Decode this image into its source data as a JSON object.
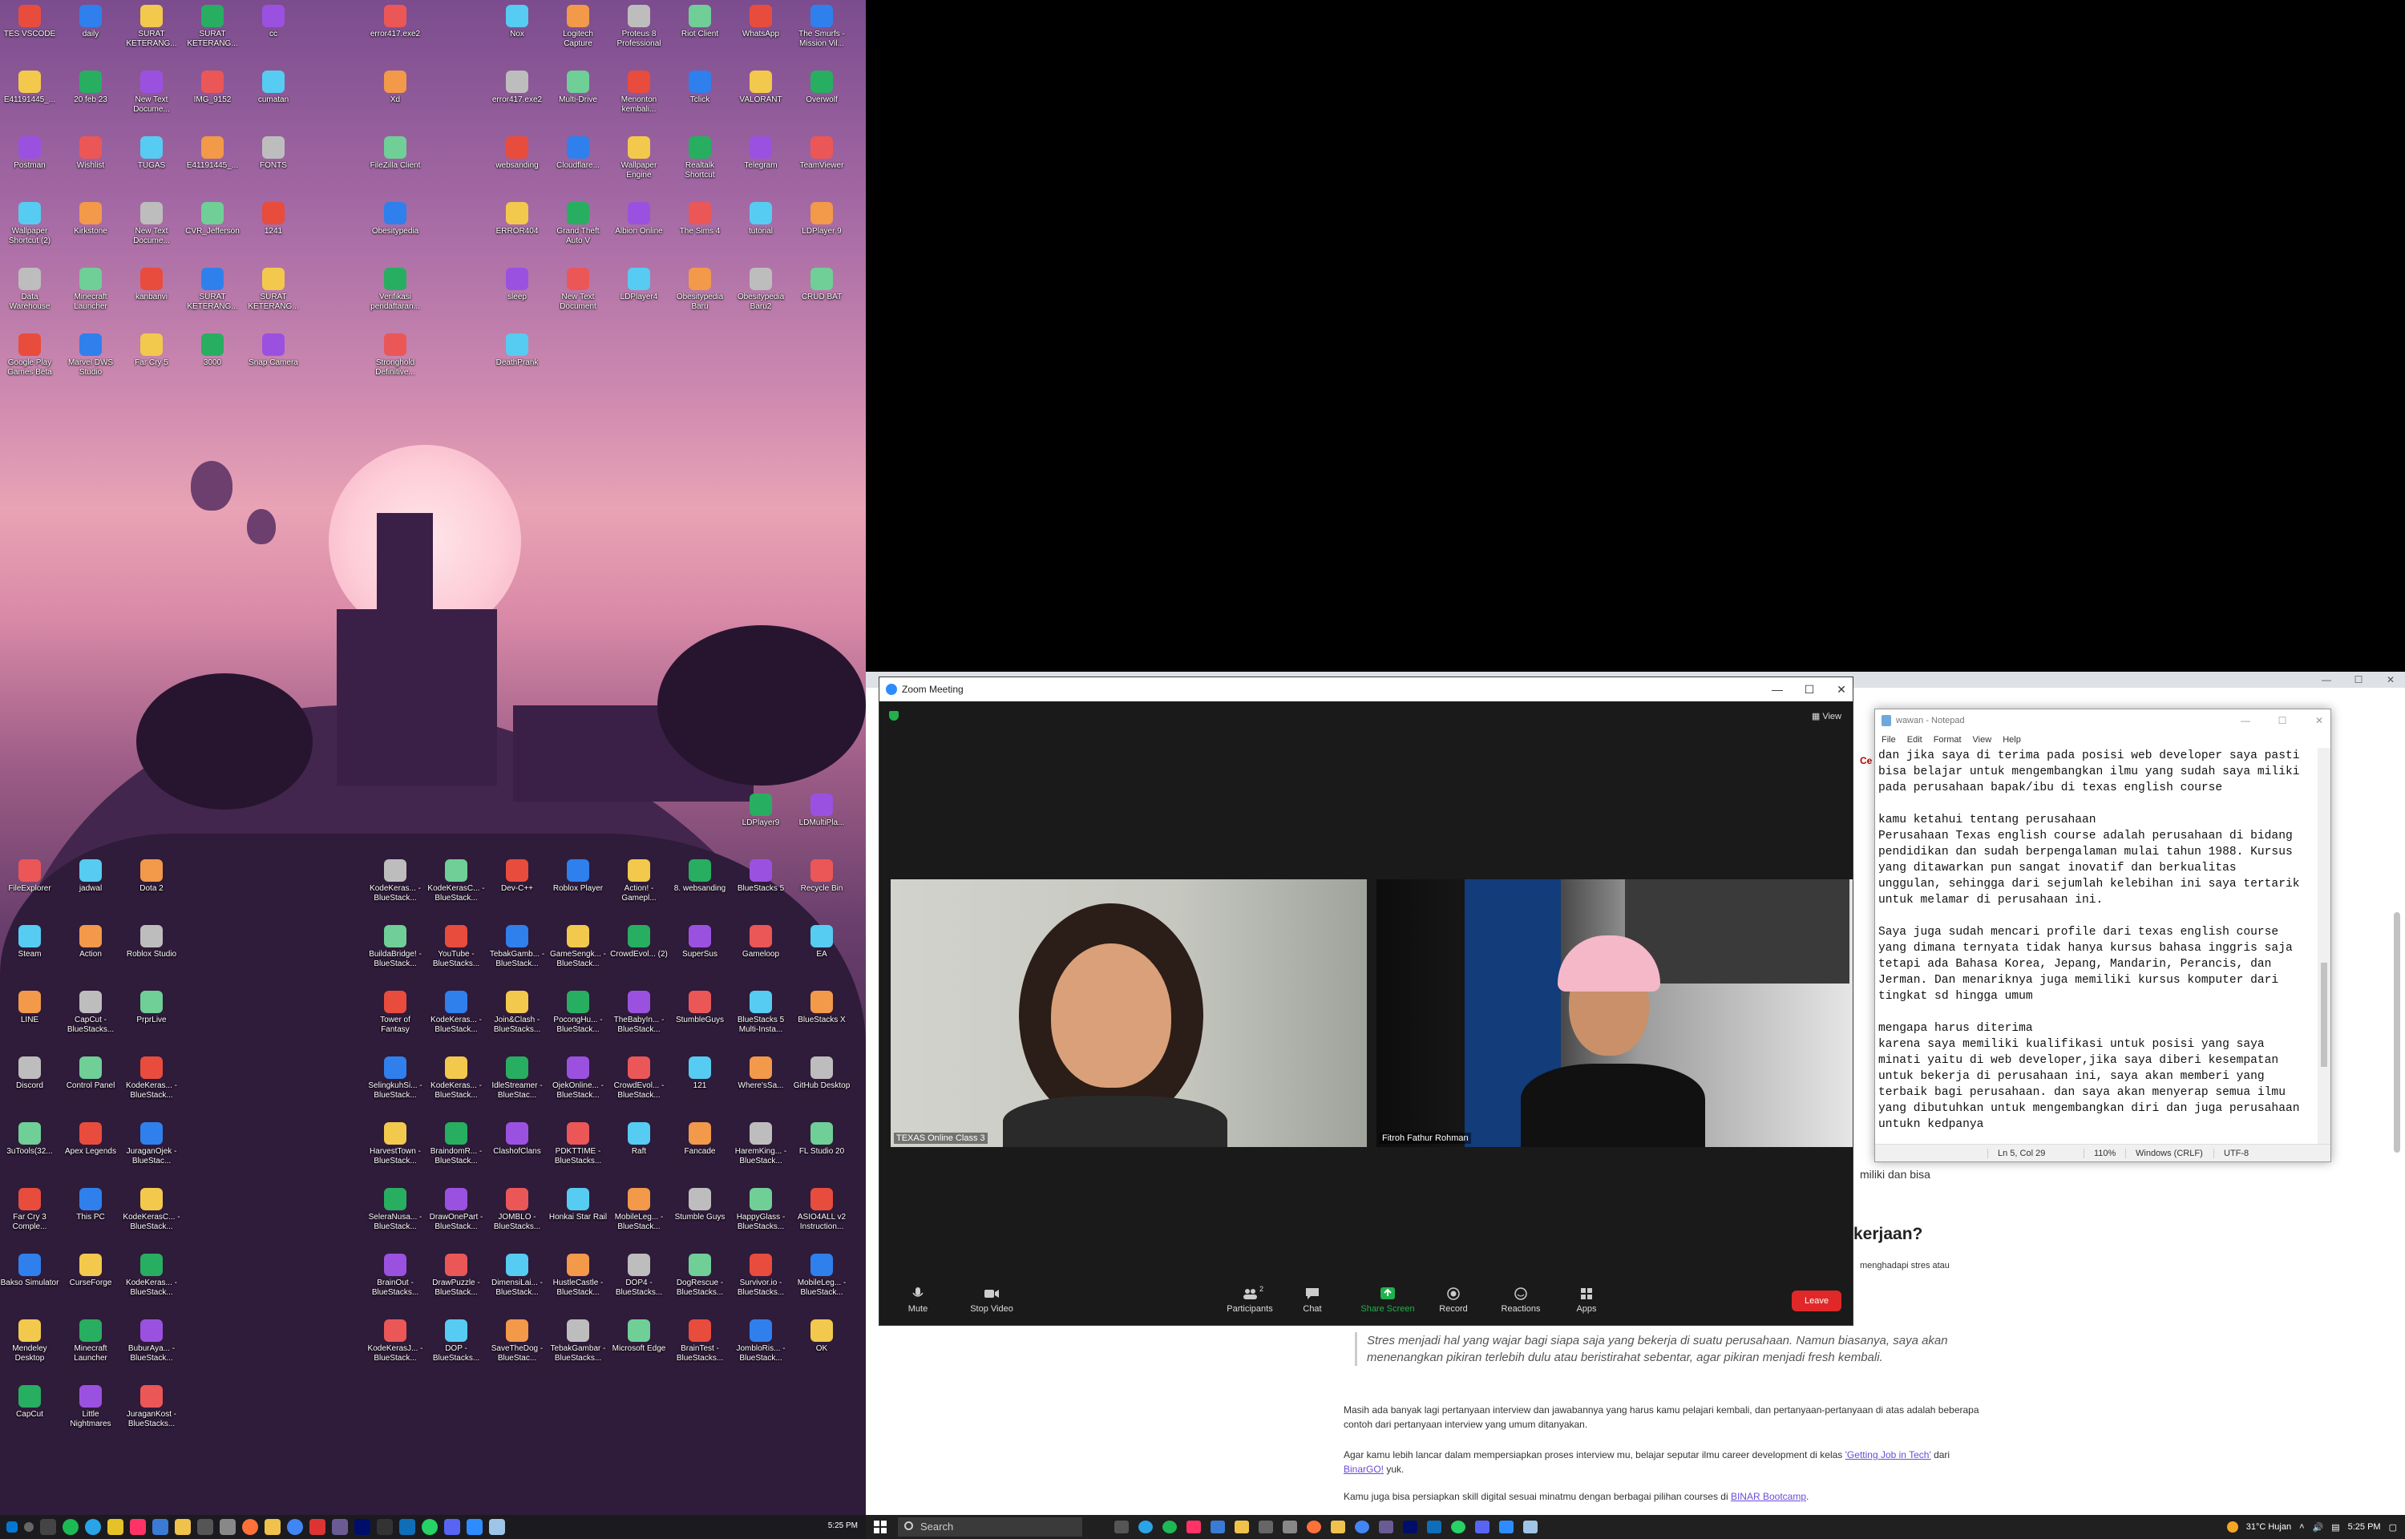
{
  "left_desktop": {
    "icons_top": [
      "TES VSCODE",
      "daily",
      "SURAT KETERANG...",
      "SURAT KETERANG...",
      "cc",
      "error417.exe2",
      "Nox",
      "Logitech Capture",
      "Proteus 8 Professional",
      "Riot Client",
      "WhatsApp",
      "The Smurfs - Mission Vil...",
      "E41191445_...",
      "20 feb 23",
      "New Text Docume...",
      "IMG_9152",
      "cumatan",
      "Xd",
      "error417.exe2",
      "Multi-Drive",
      "Menonton kembali...",
      "Tclick",
      "VALORANT",
      "Overwolf",
      "Postman",
      "Wishlist",
      "TUGAS",
      "E41191445_...",
      "FONTS",
      "FileZilla Client",
      "websanding",
      "Cloudflare...",
      "Wallpaper Engine",
      "Realtalk Shortcut",
      "Telegram",
      "TeamViewer",
      "Wallpaper Shortcut (2)",
      "Kirkstone",
      "New Text Docume...",
      "CVR_Jefferson",
      "1241",
      "Obesitypedia",
      "ERROR404",
      "Grand Theft Auto V",
      "Albion Online",
      "The Sims 4",
      "tutorial",
      "LDPlayer 9",
      "Data Warehouse",
      "Minecraft Launcher",
      "kanbanvi",
      "SURAT KETERANG...",
      "SURAT KETERANG...",
      "Verifikasi pendaftaran...",
      "sleep",
      "New Text Document",
      "LDPlayer4",
      "Obesitypedia Baru",
      "Obesitypedia Baru2",
      "CRUD BAT",
      "Google Play Games Beta",
      "Marvel DWS Studio",
      "Far Cry 5",
      "3000",
      "Snap Camera",
      "Stronghold Definitive...",
      "DeathPrank"
    ],
    "icons_bottom": [
      "LDPlayer9",
      "LDMultiPla...",
      "FileExplorer",
      "jadwal",
      "Dota 2",
      "KodeKeras... - BlueStack...",
      "KodeKerasC... - BlueStack...",
      "Dev-C++",
      "Roblox Player",
      "Action! - Gamepl...",
      "8. websanding",
      "BlueStacks 5",
      "Recycle Bin",
      "Steam",
      "Action",
      "Roblox Studio",
      "BuildaBridge! - BlueStack...",
      "YouTube - BlueStacks...",
      "TebakGamb... - BlueStack...",
      "GameSengk... - BlueStack...",
      "CrowdEvol... (2)",
      "SuperSus",
      "Gameloop",
      "EA",
      "LINE",
      "CapCut - BlueStacks...",
      "PrprLive",
      "Tower of Fantasy",
      "KodeKeras... - BlueStack...",
      "Join&Clash - BlueStacks...",
      "PocongHu... - BlueStack...",
      "TheBabyIn... - BlueStack...",
      "StumbleGuys",
      "BlueStacks 5 Multi-Insta...",
      "BlueStacks X",
      "Discord",
      "Control Panel",
      "KodeKeras... - BlueStack...",
      "SelingkuhSi... - BlueStack...",
      "KodeKeras... - BlueStack...",
      "IdleStreamer - BlueStac...",
      "OjekOnline... - BlueStack...",
      "CrowdEvol... - BlueStack...",
      "121",
      "Where'sSa...",
      "GitHub Desktop",
      "3uTools(32...",
      "Apex Legends",
      "JuraganOjek - BlueStac...",
      "HarvestTown - BlueStack...",
      "BraindomR... - BlueStack...",
      "ClashofClans",
      "PDKTTIME - BlueStacks...",
      "Raft",
      "Fancade",
      "HaremKing... - BlueStack...",
      "FL Studio 20",
      "Far Cry 3 Comple...",
      "This PC",
      "KodeKerasC... - BlueStack...",
      "SeleraNusa... - BlueStack...",
      "DrawOnePart - BlueStack...",
      "JOMBLO - BlueStacks...",
      "Honkai Star Rail",
      "MobileLeg... - BlueStack...",
      "Stumble Guys",
      "HappyGlass - BlueStacks...",
      "ASIO4ALL v2 Instruction...",
      "Bakso Simulator",
      "CurseForge",
      "KodeKeras... - BlueStack...",
      "BrainOut - BlueStacks...",
      "DrawPuzzle - BlueStack...",
      "DimensiLai... - BlueStack...",
      "HustleCastle - BlueStack...",
      "DOP4 - BlueStacks...",
      "DogRescue - BlueStacks...",
      "Survivor.io - BlueStacks...",
      "MobileLeg... - BlueStack...",
      "Mendeley Desktop",
      "Minecraft Launcher",
      "BuburAya... - BlueStack...",
      "KodeKerasJ... - BlueStack...",
      "DOP - BlueStacks...",
      "SaveTheDog - BlueStac...",
      "TebakGambar - BlueStacks...",
      "Microsoft Edge",
      "BrainTest - BlueStacks...",
      "JombloRis... - BlueStack...",
      "OK",
      "CapCut",
      "Little Nightmares",
      "JuraganKost - BlueStacks..."
    ],
    "taskbar_time": "5:25 PM"
  },
  "browser_page": {
    "tab_fragment": "Ce",
    "line_fragment_1": "miliki dan bisa",
    "heading": "kerjaan?",
    "line_fragment_2": "menghadapi stres atau",
    "quote": "Stres menjadi hal yang wajar bagi siapa saja yang bekerja di suatu perusahaan. Namun biasanya, saya akan menenangkan pikiran terlebih dulu atau beristirahat sebentar, agar pikiran menjadi fresh kembali.",
    "para1": "Masih ada banyak lagi pertanyaan interview dan jawabannya yang harus kamu pelajari kembali, dan pertanyaan-pertanyaan di atas adalah beberapa contoh dari pertanyaan interview yang umum ditanyakan.",
    "para2_pre": "Agar kamu lebih lancar dalam mempersiapkan proses interview mu, belajar seputar ilmu career development di kelas ",
    "para2_link1": "'Getting Job in Tech'",
    "para2_mid": " dari ",
    "para2_link2": "BinarGO!",
    "para2_post": " yuk.",
    "para3_pre": "Kamu juga bisa persiapkan skill digital sesuai minatmu dengan berbagai pilihan courses di ",
    "para3_link": "BINAR Bootcamp",
    "para3_post": "."
  },
  "zoom": {
    "title": "Zoom Meeting",
    "view_label": "View",
    "participant_a": "TEXAS Online Class 3",
    "participant_b": "Fitroh Fathur Rohman",
    "toolbar": {
      "mute": "Mute",
      "stop_video": "Stop Video",
      "participants": "Participants",
      "participants_count": "2",
      "chat": "Chat",
      "share_screen": "Share Screen",
      "record": "Record",
      "reactions": "Reactions",
      "apps": "Apps",
      "leave": "Leave"
    },
    "colors": {
      "share_green": "#22b14c",
      "leave_red": "#e02828"
    }
  },
  "notepad": {
    "title": "wawan - Notepad",
    "menu": [
      "File",
      "Edit",
      "Format",
      "View",
      "Help"
    ],
    "content": "dan jika saya di terima pada posisi web developer saya pasti\nbisa belajar untuk mengembangkan ilmu yang sudah saya miliki\npada perusahaan bapak/ibu di texas english course\n\nkamu ketahui tentang perusahaan\nPerusahaan Texas english course adalah perusahaan di bidang\npendidikan dan sudah berpengalaman mulai tahun 1988. Kursus\nyang ditawarkan pun sangat inovatif dan berkualitas\nunggulan, sehingga dari sejumlah kelebihan ini saya tertarik\nuntuk melamar di perusahaan ini.\n\nSaya juga sudah mencari profile dari texas english course\nyang dimana ternyata tidak hanya kursus bahasa inggris saja\ntetapi ada Bahasa Korea, Jepang, Mandarin, Perancis, dan\nJerman. Dan menariknya juga memiliki kursus komputer dari\ntingkat sd hingga umum\n\nmengapa harus diterima\nkarena saya memiliki kualifikasi untuk posisi yang saya\nminati yaitu di web developer,jika saya diberi kesempatan\nuntuk bekerja di perusahaan ini, saya akan memberi yang\nterbaik bagi perusahaan. dan saya akan menyerap semua ilmu\nyang dibutuhkan untuk mengembangkan diri dan juga perusahaan\nuntukn kedpanya",
    "status": {
      "position": "Ln 5, Col 29",
      "zoom": "110%",
      "line_ending": "Windows (CRLF)",
      "encoding": "UTF-8"
    }
  },
  "right_taskbar": {
    "search_placeholder": "Search",
    "weather": "31°C  Hujan",
    "time": "5:25 PM"
  }
}
